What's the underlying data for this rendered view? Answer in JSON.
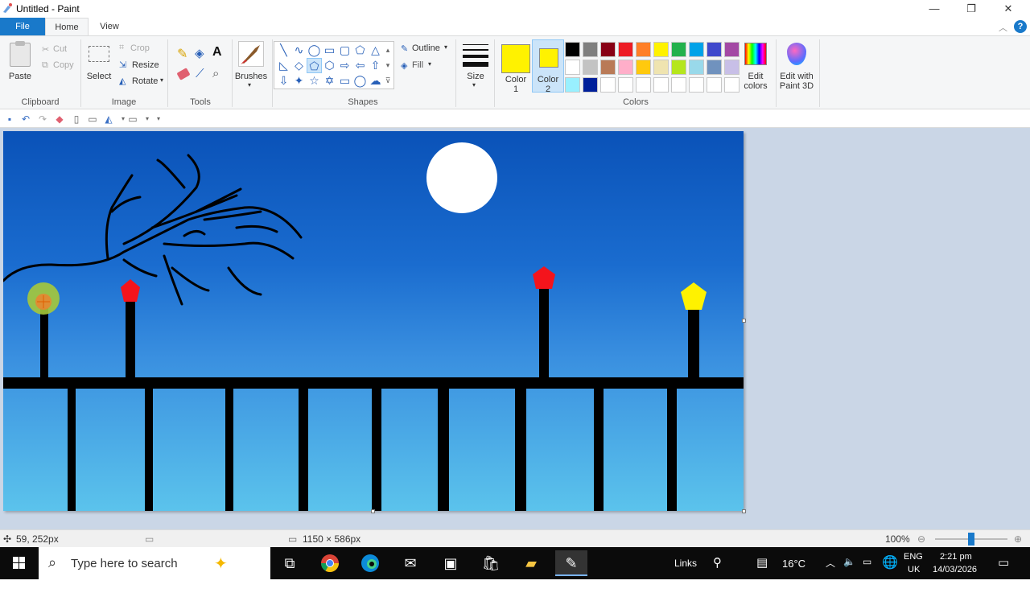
{
  "window": {
    "title": "Untitled - Paint",
    "minimize": "—",
    "maximize": "❐",
    "close": "✕"
  },
  "tabs": {
    "file": "File",
    "home": "Home",
    "view": "View",
    "help": "?"
  },
  "ribbon": {
    "clipboard": {
      "label": "Clipboard",
      "paste": "Paste",
      "cut": "Cut",
      "copy": "Copy"
    },
    "image": {
      "label": "Image",
      "select": "Select",
      "crop": "Crop",
      "resize": "Resize",
      "rotate": "Rotate"
    },
    "tools": {
      "label": "Tools"
    },
    "brushes": {
      "label": "Brushes"
    },
    "shapes": {
      "label": "Shapes",
      "outline": "Outline",
      "fill": "Fill"
    },
    "size": {
      "label": "Size"
    },
    "colors": {
      "label": "Colors",
      "color1_label": "Color",
      "color1_num": "1",
      "color2_label": "Color",
      "color2_num": "2",
      "color1_value": "#fff200",
      "color2_value": "#fff200",
      "edit_colors": "Edit",
      "edit_colors2": "colors",
      "edit_paint3d": "Edit with",
      "edit_paint3d2": "Paint 3D",
      "palette_row1": [
        "#000000",
        "#7f7f7f",
        "#880015",
        "#ed1c24",
        "#ff7f27",
        "#fff200",
        "#22b14c",
        "#00a2e8",
        "#3f48cc",
        "#a349a4"
      ],
      "palette_row2": [
        "#ffffff",
        "#c3c3c3",
        "#b97a57",
        "#ffaec9",
        "#ffc90e",
        "#efe4b0",
        "#b5e61d",
        "#99d9ea",
        "#7092be",
        "#c8bfe7"
      ],
      "palette_row3": [
        "#99f0ff",
        "#001f9a",
        "#ffffff",
        "#ffffff",
        "#ffffff",
        "#ffffff",
        "#ffffff",
        "#ffffff",
        "#ffffff",
        "#ffffff"
      ]
    }
  },
  "status": {
    "cursor_pos": "59, 252px",
    "canvas_size": "1150 × 586px",
    "zoom": "100%"
  },
  "taskbar": {
    "search_placeholder": "Type here to search",
    "links": "Links",
    "temperature": "16°C",
    "lang1": "ENG",
    "lang2": "UK",
    "time": "2:21 pm",
    "date": "14/03/2026"
  }
}
